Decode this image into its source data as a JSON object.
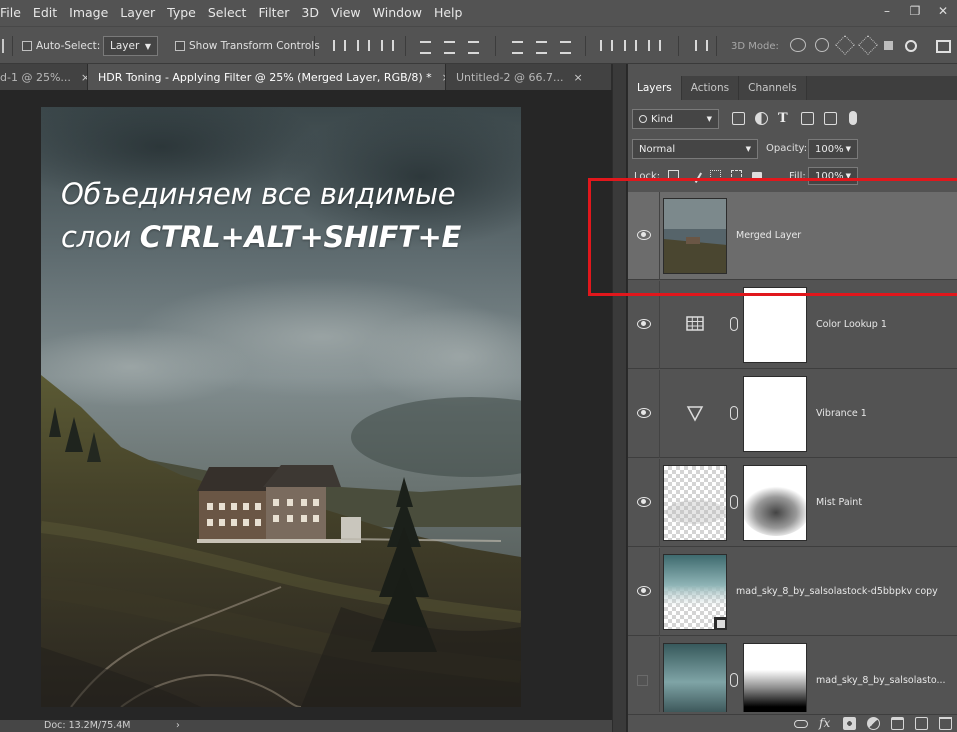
{
  "menubar": {
    "items": [
      "File",
      "Edit",
      "Image",
      "Layer",
      "Type",
      "Select",
      "Filter",
      "3D",
      "View",
      "Window",
      "Help"
    ]
  },
  "window_controls": {
    "minimize": "–",
    "restore": "❐",
    "close": "✕"
  },
  "options_bar": {
    "auto_select_label": "Auto-Select:",
    "auto_select_target": "Layer",
    "show_transform_label": "Show Transform Controls",
    "mode_3d_label": "3D Mode:"
  },
  "tabs": [
    {
      "label": "d-1 @ 25%...",
      "close": "×",
      "active": false
    },
    {
      "label": "HDR Toning - Applying Filter @ 25% (Merged Layer, RGB/8) *",
      "close": "×",
      "active": true
    },
    {
      "label": "Untitled-2 @ 66.7...",
      "close": "×",
      "active": false
    }
  ],
  "canvas": {
    "overlay_line1": "Объединяем все видимые",
    "overlay_line2_prefix": "слои ",
    "overlay_line2_bold": "CTRL+ALT+SHIFT+E"
  },
  "status": {
    "doc_size": "Doc: 13.2M/75.4M",
    "arrow": "›"
  },
  "panel": {
    "tabs": [
      "Layers",
      "Actions",
      "Channels"
    ],
    "active_tab": "Layers",
    "filter_kind": "Kind",
    "blend_mode": "Normal",
    "opacity_label": "Opacity:",
    "opacity_value": "100%",
    "lock_label": "Lock:",
    "fill_label": "Fill:",
    "fill_value": "100%"
  },
  "layers": [
    {
      "name": "Merged Layer",
      "visible": true,
      "selected": true,
      "type": "pixel"
    },
    {
      "name": "Color Lookup 1",
      "visible": true,
      "selected": false,
      "type": "adjustment-grid"
    },
    {
      "name": "Vibrance 1",
      "visible": true,
      "selected": false,
      "type": "adjustment-triangle"
    },
    {
      "name": "Mist Paint",
      "visible": true,
      "selected": false,
      "type": "masked-paint"
    },
    {
      "name": "mad_sky_8_by_salsolastock-d5bbpkv copy",
      "visible": true,
      "selected": false,
      "type": "smart-sky"
    },
    {
      "name": "mad_sky_8_by_salsolasto...",
      "visible": false,
      "selected": false,
      "type": "sky-masked"
    }
  ],
  "colors": {
    "highlight_box": "#e1171c",
    "panel_bg": "#535353",
    "selected_layer": "#6c6c6c"
  }
}
